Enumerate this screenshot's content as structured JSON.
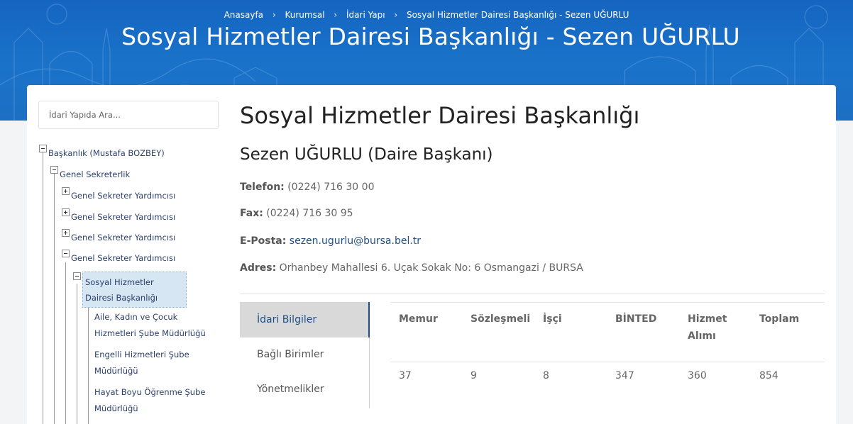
{
  "breadcrumb": {
    "home": "Anasayfa",
    "corporate": "Kurumsal",
    "admin": "İdari Yapı",
    "current": "Sosyal Hizmetler Dairesi Başkanlığı - Sezen UĞURLU"
  },
  "hero": {
    "title": "Sosyal Hizmetler Dairesi Başkanlığı - Sezen UĞURLU"
  },
  "search": {
    "placeholder": "İdari Yapıda Ara..."
  },
  "tree": {
    "root": "Başkanlık (Mustafa BOZBEY)",
    "general_secretary": "Genel Sekreterlik",
    "deputy_1": "Genel Sekreter Yardımcısı",
    "deputy_2": "Genel Sekreter Yardımcısı",
    "deputy_3": "Genel Sekreter Yardımcısı",
    "deputy_4": "Genel Sekreter Yardımcısı",
    "selected": "Sosyal Hizmetler Dairesi Başkanlığı",
    "child_1": "Aile, Kadın ve Çocuk Hizmetleri Şube Müdürlüğü",
    "child_2": "Engelli Hizmetleri Şube Müdürlüğü",
    "child_3": "Hayat Boyu Öğrenme Şube Müdürlüğü"
  },
  "main": {
    "title": "Sosyal Hizmetler Dairesi Başkanlığı",
    "person": "Sezen UĞURLU (Daire Başkanı)"
  },
  "contact": {
    "phone_label": "Telefon:",
    "phone": "(0224) 716 30 00",
    "fax_label": "Fax:",
    "fax": "(0224) 716 30 95",
    "email_label": "E-Posta:",
    "email": "sezen.ugurlu@bursa.bel.tr",
    "address_label": "Adres:",
    "address": "Orhanbey Mahallesi 6. Uçak Sokak No: 6 Osmangazi / BURSA"
  },
  "tabs": [
    {
      "label": "İdari Bilgiler",
      "active": true
    },
    {
      "label": "Bağlı Birimler",
      "active": false
    },
    {
      "label": "Yönetmelikler",
      "active": false
    }
  ],
  "staff_table": {
    "headers": [
      "Memur",
      "Sözleşmeli",
      "İşçi",
      "BİNTED",
      "Hizmet Alımı",
      "Toplam"
    ],
    "values": [
      "37",
      "9",
      "8",
      "347",
      "360",
      "854"
    ]
  },
  "colors": {
    "hero": "#1a6fc4",
    "link": "#1f4f86",
    "active_tab": "#d9d9d9"
  }
}
